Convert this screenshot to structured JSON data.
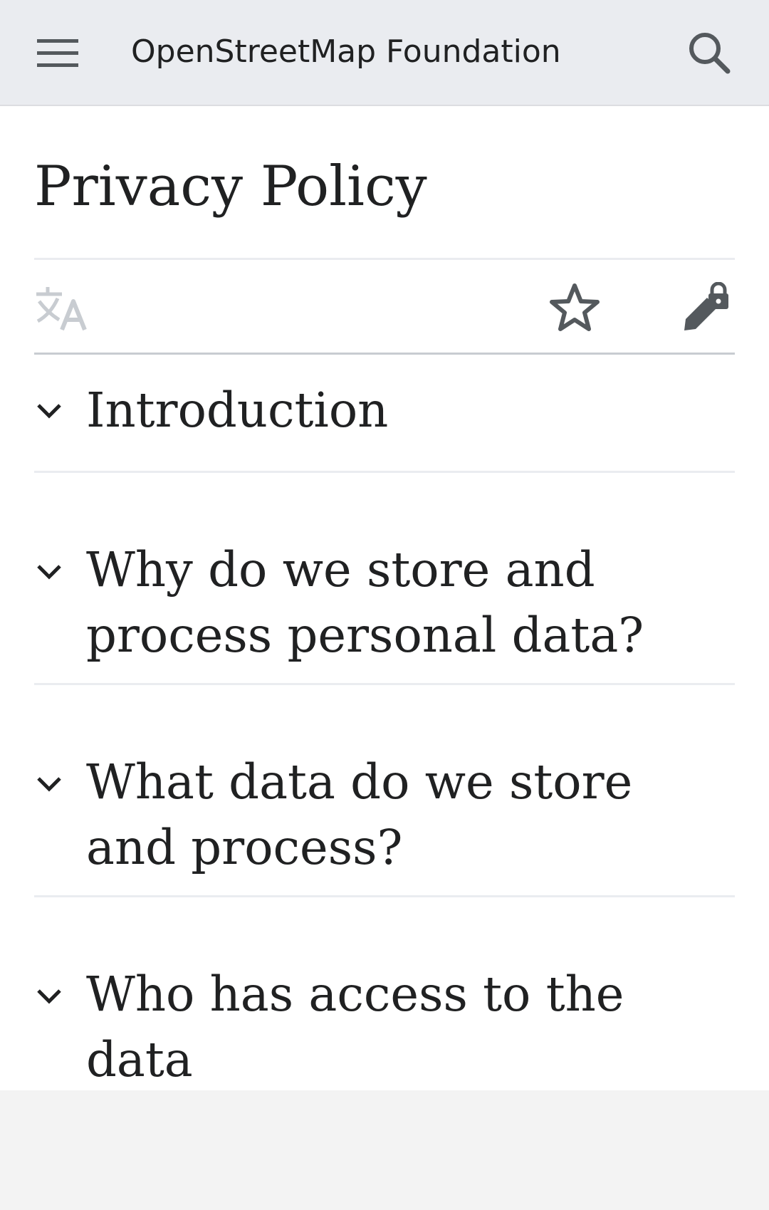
{
  "header": {
    "site_title": "OpenStreetMap Foundation",
    "menu_icon": "hamburger-menu-icon",
    "search_icon": "search-icon"
  },
  "page": {
    "title": "Privacy Policy"
  },
  "page_actions": {
    "language_icon": "language-translate-icon",
    "watch_icon": "star-outline-icon",
    "edit_icon": "edit-locked-icon"
  },
  "sections": [
    {
      "title": "Introduction"
    },
    {
      "title": "Why do we store and process personal data?"
    },
    {
      "title": "What data do we store and process?"
    },
    {
      "title": "Who has access to the data"
    }
  ],
  "colors": {
    "header_bg": "#eaecf0",
    "text": "#202122",
    "divider": "#eaecf0",
    "footer_bg": "#f3f3f3",
    "disabled_icon": "#c8ccd1"
  }
}
